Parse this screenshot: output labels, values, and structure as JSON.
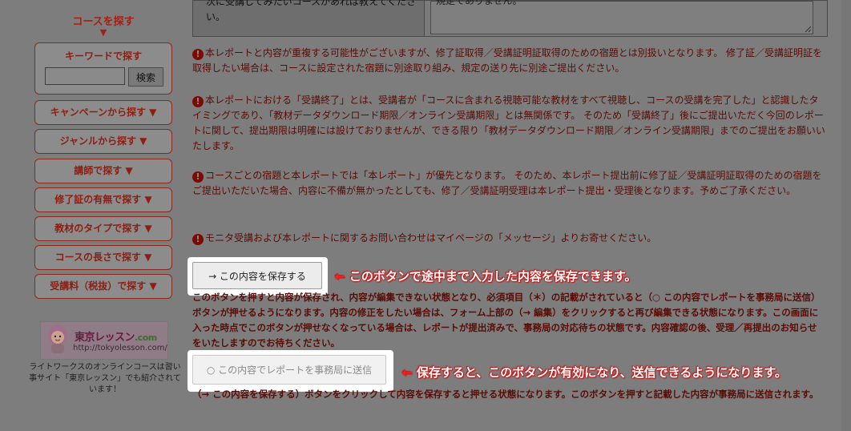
{
  "sidebar": {
    "title": "コースを探す",
    "title_arrow": "▼",
    "keyword": {
      "label": "キーワードで探す",
      "input_value": "",
      "button_label": "検索"
    },
    "items": [
      {
        "label": "キャンペーンから探す ▼"
      },
      {
        "label": "ジャンルから探す ▼"
      },
      {
        "label": "講師で探す ▼"
      },
      {
        "label": "修了証の有無で探す ▼"
      },
      {
        "label": "教材のタイプで探す ▼"
      },
      {
        "label": "コースの長さで探す ▼"
      },
      {
        "label": "受講料（税抜）で探す ▼"
      }
    ],
    "logo": {
      "name": "東京レッスン",
      "suffix": ".com",
      "url": "http://tokyolesson.com/"
    },
    "caption": "ライトワークスのオンラインコースは習い事サイト「東京レッスン」でも紹介されています！"
  },
  "form": {
    "question": "次に受講してみたいコースがあれば教えてください。",
    "answer": "規定でありません。"
  },
  "notes": [
    {
      "text": "本レポートと内容が重複する可能性がございますが、修了証取得／受講証明証取得のための宿題とは別扱いとなります。 修了証／受講証明証を取得したい場合は、コースに設定された宿題に別途取り組み、規定の送り先に別途ご提出ください。"
    },
    {
      "text": "本レポートにおける「受講終了」とは、受講者が「コースに含まれる視聴可能な教材をすべて視聴し、コースの受講を完了した」と認識したタイミングであり、「教材データダウンロード期限／オンライン受講期限」とは無関係です。 そのため「受講終了」後にご提出いただく今回のレポートに関して、提出期限は明確には設けておりませんが、できる限り「教材データダウンロード期限／オンライン受講期限」までのご提出をお願いいたします。"
    },
    {
      "text": "コースごとの宿題と本レポートでは「本レポート」が優先となります。 そのため、本レポート提出前に修了証／受講証明証取得のための宿題をご提出いただいた場合、内容に不備が無かったとしても、修了／受講証明受理は本レポート提出・受理後となります。予めご了承ください。"
    },
    {
      "text": "モニタ受講および本レポートに関するお問い合わせはマイページの「メッセージ」よりお寄せください。"
    }
  ],
  "save_button": {
    "label": "→ この内容を保存する"
  },
  "save_callout": {
    "arrow": "←",
    "text": "このボタンで途中まで入力した内容を保存できます。"
  },
  "save_help": "このボタンを押すと内容が保存され、内容が編集できない状態となり、必須項目（＊）の記載がされていると（○ この内容でレポートを事務局に送信）ボタンが押せるようになります。内容の修正をしたい場合は、フォーム上部の（→ 編集）をクリックすると再び編集できる状態になります。この画面に入った時点でこのボタンが押せなくなっている場合は、レポートが提出済みで、事務局の対応待ちの状態です。内容確認の後、受理／再提出のお知らせをいたしますのでお待ちください。",
  "submit_button": {
    "label": "○ この内容でレポートを事務局に送信",
    "disabled": true
  },
  "submit_callout": {
    "arrow": "←",
    "text": "保存すると、このボタンが有効になり、送信できるようになります。"
  },
  "submit_help": "（→ この内容を保存する）ボタンをクリックして内容を保存すると押せる状態になります。このボタンを押すと記載した内容が事務局に送信されます。",
  "colors": {
    "overlay": "#7d7d7d",
    "accent": "#8e1d12",
    "callout": "#ff2020"
  }
}
